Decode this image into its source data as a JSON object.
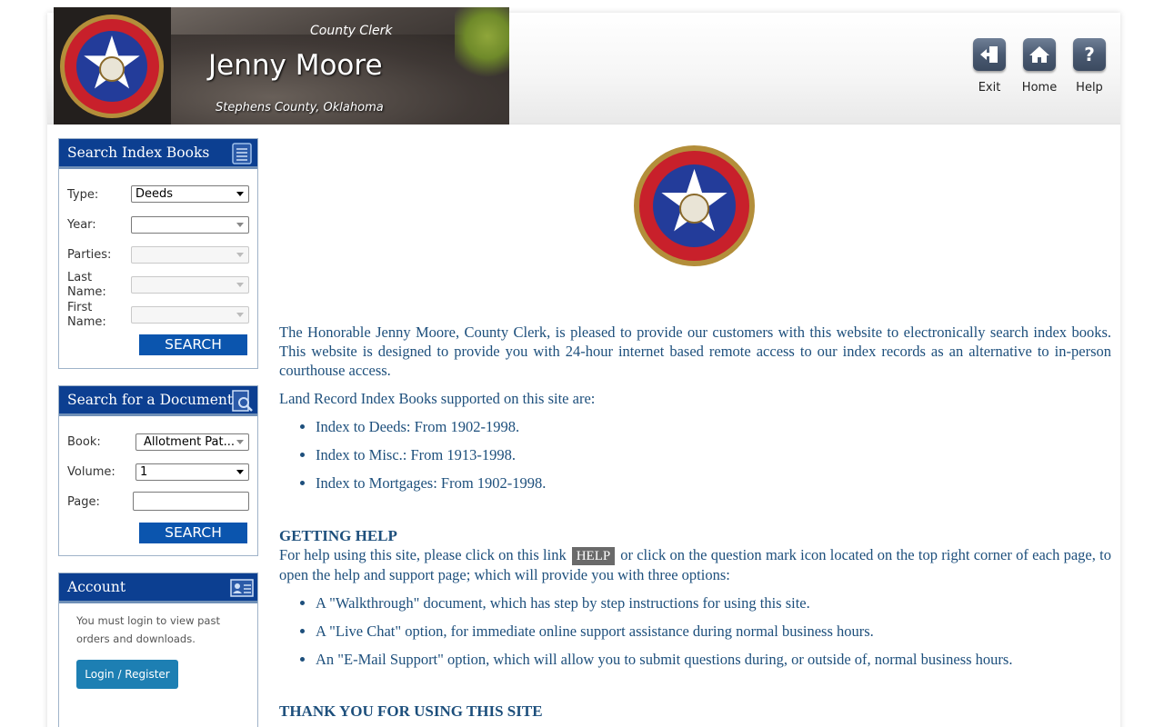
{
  "banner": {
    "office": "County Clerk",
    "name": "Jenny Moore",
    "location": "Stephens County, Oklahoma"
  },
  "topnav": [
    {
      "label": "Exit",
      "icon": "exit-icon"
    },
    {
      "label": "Home",
      "icon": "home-icon"
    },
    {
      "label": "Help",
      "icon": "help-icon"
    }
  ],
  "search_index": {
    "title": "Search Index Books",
    "type_label": "Type:",
    "type_value": "Deeds",
    "year_label": "Year:",
    "year_value": "",
    "parties_label": "Parties:",
    "last_name_label": "Last Name:",
    "first_name_label": "First Name:",
    "button": "SEARCH"
  },
  "search_document": {
    "title": "Search for a Document",
    "book_label": "Book:",
    "book_value": "Allotment Pat...",
    "volume_label": "Volume:",
    "volume_value": "1",
    "page_label": "Page:",
    "page_value": "",
    "button": "SEARCH"
  },
  "account": {
    "title": "Account",
    "message": "You must login to view past orders and downloads.",
    "button": "Login / Register"
  },
  "main": {
    "intro": "The Honorable Jenny Moore, County Clerk, is pleased to provide our customers with this website to electronically search index books. This website is designed to provide you with 24-hour internet based remote access to our index records as an alternative to in-person courthouse access.",
    "supported_heading": "Land Record Index Books supported on this site are:",
    "supported": [
      "Index to Deeds: From 1902-1998.",
      "Index to Misc.: From 1913-1998.",
      "Index to Mortgages: From 1902-1998."
    ],
    "help_heading": "GETTING HELP",
    "help_text_before": "For help using this site, please click on this link",
    "help_link": "HELP",
    "help_text_after": "or click on the question mark icon located on the top right corner of each page, to open the help and support page; which will provide you with three options:",
    "help_options": [
      "A \"Walkthrough\" document, which has step by step instructions for using this site.",
      "A \"Live Chat\" option, for immediate online support assistance during normal business hours.",
      "An \"E-Mail Support\" option, which will allow you to submit questions during, or outside of, normal business hours."
    ],
    "thanks_heading": "THANK YOU FOR USING THIS SITE"
  },
  "colors": {
    "panel_header": "#0c3f91",
    "search_button": "#0b55ae",
    "body_text": "#1d4f7c",
    "login_button": "#1d7fb3"
  }
}
